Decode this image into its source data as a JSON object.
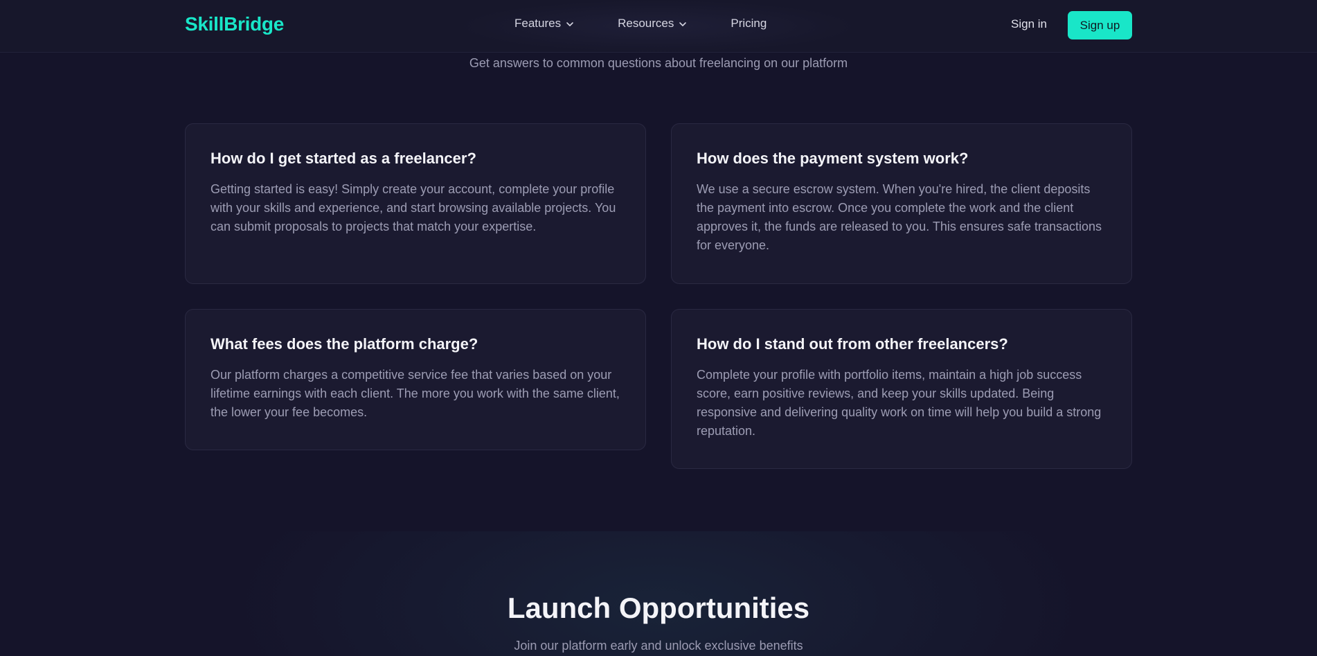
{
  "nav": {
    "logo": "SkillBridge",
    "links": [
      {
        "label": "Features",
        "has_dropdown": true
      },
      {
        "label": "Resources",
        "has_dropdown": true
      },
      {
        "label": "Pricing",
        "has_dropdown": false
      }
    ],
    "sign_in": "Sign in",
    "sign_up": "Sign up"
  },
  "faq": {
    "subtitle": "Get answers to common questions about freelancing on our platform",
    "items": [
      {
        "question": "How do I get started as a freelancer?",
        "answer": "Getting started is easy! Simply create your account, complete your profile with your skills and experience, and start browsing available projects. You can submit proposals to projects that match your expertise."
      },
      {
        "question": "How does the payment system work?",
        "answer": "We use a secure escrow system. When you're hired, the client deposits the payment into escrow. Once you complete the work and the client approves it, the funds are released to you. This ensures safe transactions for everyone."
      },
      {
        "question": "What fees does the platform charge?",
        "answer": "Our platform charges a competitive service fee that varies based on your lifetime earnings with each client. The more you work with the same client, the lower your fee becomes."
      },
      {
        "question": "How do I stand out from other freelancers?",
        "answer": "Complete your profile with portfolio items, maintain a high job success score, earn positive reviews, and keep your skills updated. Being responsive and delivering quality work on time will help you build a strong reputation."
      }
    ]
  },
  "launch": {
    "title": "Launch Opportunities",
    "subtitle": "Join our platform early and unlock exclusive benefits"
  },
  "colors": {
    "accent": "#19e6c8",
    "background": "#15142a",
    "card": "#1b1a30",
    "muted_text": "#9d9db4"
  }
}
